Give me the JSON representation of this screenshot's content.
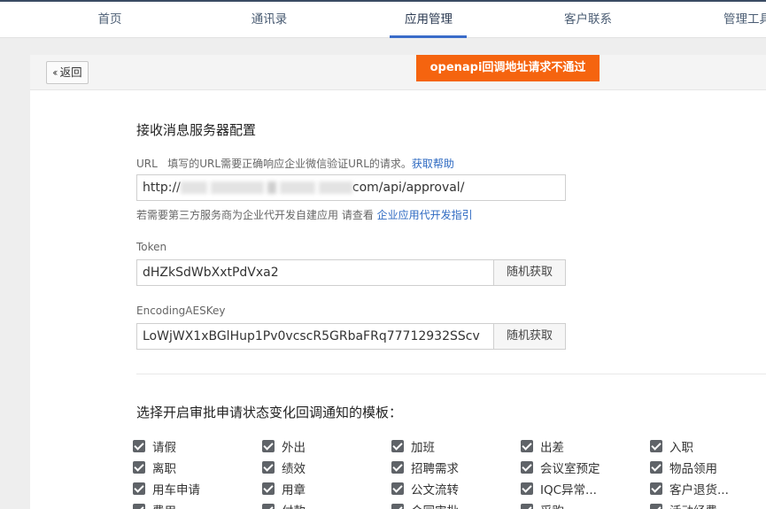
{
  "nav": {
    "tabs": [
      {
        "label": "首页",
        "active": false
      },
      {
        "label": "通讯录",
        "active": false
      },
      {
        "label": "应用管理",
        "active": true
      },
      {
        "label": "客户联系",
        "active": false
      },
      {
        "label": "管理工具",
        "active": false
      }
    ]
  },
  "header": {
    "back_label": "返回",
    "error_message": "openapi回调地址请求不通过"
  },
  "config": {
    "title": "接收消息服务器配置",
    "url_label": "URL",
    "url_desc": "填写的URL需要正确响应企业微信验证URL的请求。",
    "url_help_link": "获取帮助",
    "url_prefix": "http://",
    "url_suffix": "com/api/approval/",
    "third_party_hint": "若需要第三方服务商为企业代开发自建应用 请查看",
    "third_party_link": "企业应用代开发指引",
    "token_label": "Token",
    "token_value": "dHZkSdWbXxtPdVxa2",
    "aeskey_label": "EncodingAESKey",
    "aeskey_value": "LoWjWX1xBGlHup1Pv0vcscR5GRbaFRq77712932SScv",
    "random_btn_label": "随机获取"
  },
  "templates": {
    "title": "选择开启审批申请状态变化回调通知的模板：",
    "items": [
      {
        "label": "请假",
        "checked": true
      },
      {
        "label": "外出",
        "checked": true
      },
      {
        "label": "加班",
        "checked": true
      },
      {
        "label": "出差",
        "checked": true
      },
      {
        "label": "入职",
        "checked": true
      },
      {
        "label": "离职",
        "checked": true
      },
      {
        "label": "绩效",
        "checked": true
      },
      {
        "label": "招聘需求",
        "checked": true
      },
      {
        "label": "会议室预定",
        "checked": true
      },
      {
        "label": "物品领用",
        "checked": true
      },
      {
        "label": "用车申请",
        "checked": true
      },
      {
        "label": "用章",
        "checked": true
      },
      {
        "label": "公文流转",
        "checked": true
      },
      {
        "label": "IQC异常...",
        "checked": true
      },
      {
        "label": "客户退货...",
        "checked": true
      },
      {
        "label": "费用",
        "checked": true
      },
      {
        "label": "付款",
        "checked": true
      },
      {
        "label": "合同审批",
        "checked": true
      },
      {
        "label": "采购",
        "checked": true
      },
      {
        "label": "活动经费",
        "checked": true
      }
    ]
  },
  "colors": {
    "accent": "#3a6cc9",
    "error": "#f5640f",
    "link": "#2e6ac2"
  }
}
